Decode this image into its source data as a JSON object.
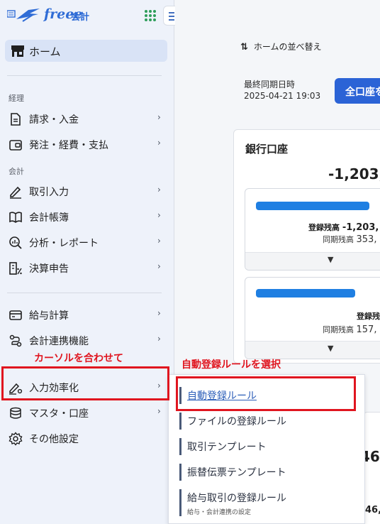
{
  "brand": {
    "logo_text": "freee",
    "product": "会計"
  },
  "sidebar": {
    "home_label": "ホーム",
    "section_accounting": "経理",
    "section_kaikei": "会計",
    "items": [
      {
        "label": "請求・入金"
      },
      {
        "label": "発注・経費・支払"
      },
      {
        "label": "取引入力"
      },
      {
        "label": "会計帳簿"
      },
      {
        "label": "分析・レポート"
      },
      {
        "label": "決算申告"
      },
      {
        "label": "給与計算"
      },
      {
        "label": "会計連携機能"
      },
      {
        "label": "入力効率化"
      },
      {
        "label": "マスタ・口座"
      },
      {
        "label": "その他設定"
      }
    ],
    "chevron": "›"
  },
  "annotations": {
    "hover_note": "カーソルを合わせて",
    "select_note": "自動登録ルールを選択",
    "highlight_color": "#e0151f"
  },
  "main": {
    "reorder_label": "ホームの並べ替え",
    "sync_label": "最終同期日時",
    "sync_value": "2025-04-21 19:03",
    "sync_button": "全口座を",
    "bank_card": {
      "title": "銀行口座",
      "total": "-1,203,",
      "accounts": [
        {
          "balance_label": "登録残高",
          "balance": "-1,203,",
          "synced_label": "同期残高",
          "synced": "353,"
        },
        {
          "balance_label": "登録残",
          "balance": "",
          "synced_label": "同期残高",
          "synced": "157,"
        }
      ]
    },
    "second_card_values": [
      "46,",
      "46,"
    ]
  },
  "flyout": {
    "items": [
      {
        "label": "自動登録ルール",
        "sub": ""
      },
      {
        "label": "ファイルの登録ルール",
        "sub": ""
      },
      {
        "label": "取引テンプレート",
        "sub": ""
      },
      {
        "label": "振替伝票テンプレート",
        "sub": ""
      },
      {
        "label": "給与取引の登録ルール",
        "sub": "給与・会計連携の設定"
      }
    ]
  }
}
